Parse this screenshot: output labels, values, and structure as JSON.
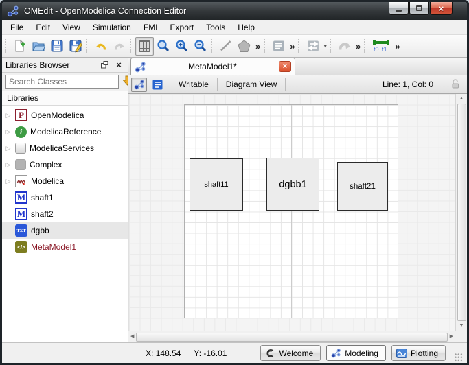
{
  "colors": {
    "titlebar_bg": "#34383b",
    "accent_blue": "#2742a8",
    "tab_close_red": "#da4f2b",
    "metamodel_text": "#8b1a28",
    "canvas_bg": "#f4f4f4",
    "component_fill": "#ececec",
    "search_arrow_gold": "#e8a41e",
    "selected_row_bg": "#e7e7e7"
  },
  "window": {
    "title": "OMEdit - OpenModelica Connection Editor"
  },
  "menubar": {
    "items": [
      "File",
      "Edit",
      "View",
      "Simulation",
      "FMI",
      "Export",
      "Tools",
      "Help"
    ]
  },
  "toolbar": {
    "more_glyph": "»",
    "caret_glyph": "▾",
    "t0_label": "t0",
    "t1_label": "t1"
  },
  "libraries_browser": {
    "title": "Libraries Browser",
    "search_placeholder": "Search Classes",
    "section_label": "Libraries",
    "items": [
      {
        "label": "OpenModelica"
      },
      {
        "label": "ModelicaReference"
      },
      {
        "label": "ModelicaServices"
      },
      {
        "label": "Complex"
      },
      {
        "label": "Modelica"
      },
      {
        "label": "shaft1"
      },
      {
        "label": "shaft2"
      },
      {
        "label": "dgbb"
      },
      {
        "label": "MetaModel1"
      }
    ]
  },
  "editor": {
    "tab_title": "MetaModel1*",
    "writable_label": "Writable",
    "view_label": "Diagram View",
    "line_col": "Line: 1, Col: 0",
    "components": [
      {
        "name": "shaft11"
      },
      {
        "name": "dgbb1"
      },
      {
        "name": "shaft21"
      }
    ]
  },
  "statusbar": {
    "x_label": "X: 148.54",
    "y_label": "Y: -16.01",
    "welcome_label": "Welcome",
    "modeling_label": "Modeling",
    "plotting_label": "Plotting"
  },
  "icons": {
    "expand_glyph": "▷",
    "openmodelica_letter": "P",
    "info_letter": "i",
    "model_letter": "M",
    "txt_label": "TXT",
    "metamodel_glyph": "</>",
    "window_close_glyph": "×",
    "panel_close_glyph": "×",
    "tab_close_glyph": "×",
    "scroll_up": "▲",
    "scroll_down": "▼",
    "scroll_left": "◀",
    "scroll_right": "▶"
  }
}
